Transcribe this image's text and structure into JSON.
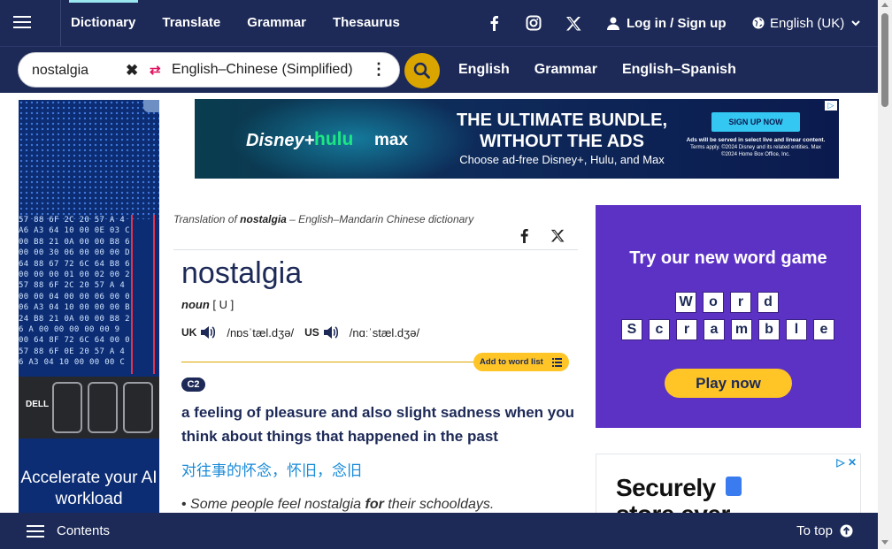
{
  "nav": {
    "links": [
      "Dictionary",
      "Translate",
      "Grammar",
      "Thesaurus"
    ],
    "active": "Dictionary",
    "social_icons": [
      "facebook-icon",
      "instagram-icon",
      "x-icon"
    ],
    "login_label": "Log in / Sign up",
    "language": "English (UK)"
  },
  "search": {
    "query": "nostalgia",
    "dictionary": "English–Chinese (Simplified)",
    "quick_links": [
      "English",
      "Grammar",
      "English–Spanish"
    ]
  },
  "entry": {
    "translation_of_prefix": "Translation of ",
    "translation_of_word": "nostalgia",
    "translation_of_suffix": " – English–Mandarin Chinese dictionary",
    "headword": "nostalgia",
    "pos": "noun",
    "grammar_code": "[ U ]",
    "uk_label": "UK",
    "uk_ipa": "/nɒsˈtæl.dʒə/",
    "us_label": "US",
    "us_ipa": "/nɑːˈstæl.dʒə/",
    "word_list_label": "Add to word list",
    "level": "C2",
    "definition": "a feeling of pleasure and also slight sadness when you think about things that happened in the past",
    "translation": "对往事的怀念，怀旧，念旧",
    "example_pre": "Some people feel nostalgia ",
    "example_bold": "for",
    "example_post": " their schooldays."
  },
  "ads": {
    "top": {
      "brand1": "Disney+",
      "brand2": "hulu",
      "brand3": "max",
      "headline": "THE ULTIMATE BUNDLE, WITHOUT THE ADS",
      "sub": "Choose ad-free Disney+, Hulu, and Max",
      "cta": "SIGN UP NOW",
      "fine1": "Ads will be served in select live and linear content.",
      "fine2": "Terms apply. ©2024 Disney and its related entities. Max ©2024 Home Box Office, Inc."
    },
    "left": {
      "logo": "DELL",
      "tagline": "Accelerate your AI workload"
    },
    "game": {
      "title": "Try our new word game",
      "word1": [
        "W",
        "o",
        "r",
        "d"
      ],
      "word2": [
        "S",
        "c",
        "r",
        "a",
        "m",
        "b",
        "l",
        "e"
      ],
      "button": "Play now"
    },
    "secure": {
      "line1": "Securely",
      "line2": "store ever"
    }
  },
  "bottom": {
    "contents_label": "Contents",
    "to_top_label": "To top"
  }
}
